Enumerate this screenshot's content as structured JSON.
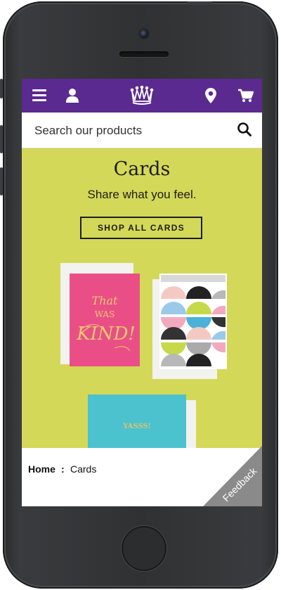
{
  "device": {
    "model": "iPhone 5s",
    "color": "#303133"
  },
  "topbar": {
    "background": "#5b2a90",
    "icons": [
      "menu-icon",
      "account-icon",
      "crown-logo-icon",
      "store-locator-icon",
      "cart-icon"
    ]
  },
  "search": {
    "placeholder": "Search our products",
    "value": ""
  },
  "hero": {
    "background": "#d4d858",
    "title": "Cards",
    "subtitle": "Share what you feel.",
    "button_label": "SHOP ALL CARDS",
    "card_left_text": "That WAS KIND!",
    "card_bottom_text": "YASSS!"
  },
  "breadcrumb": {
    "home": "Home",
    "separator": ":",
    "current": "Cards"
  },
  "feedback": {
    "label": "Feedback",
    "color": "#8a8a8a"
  }
}
